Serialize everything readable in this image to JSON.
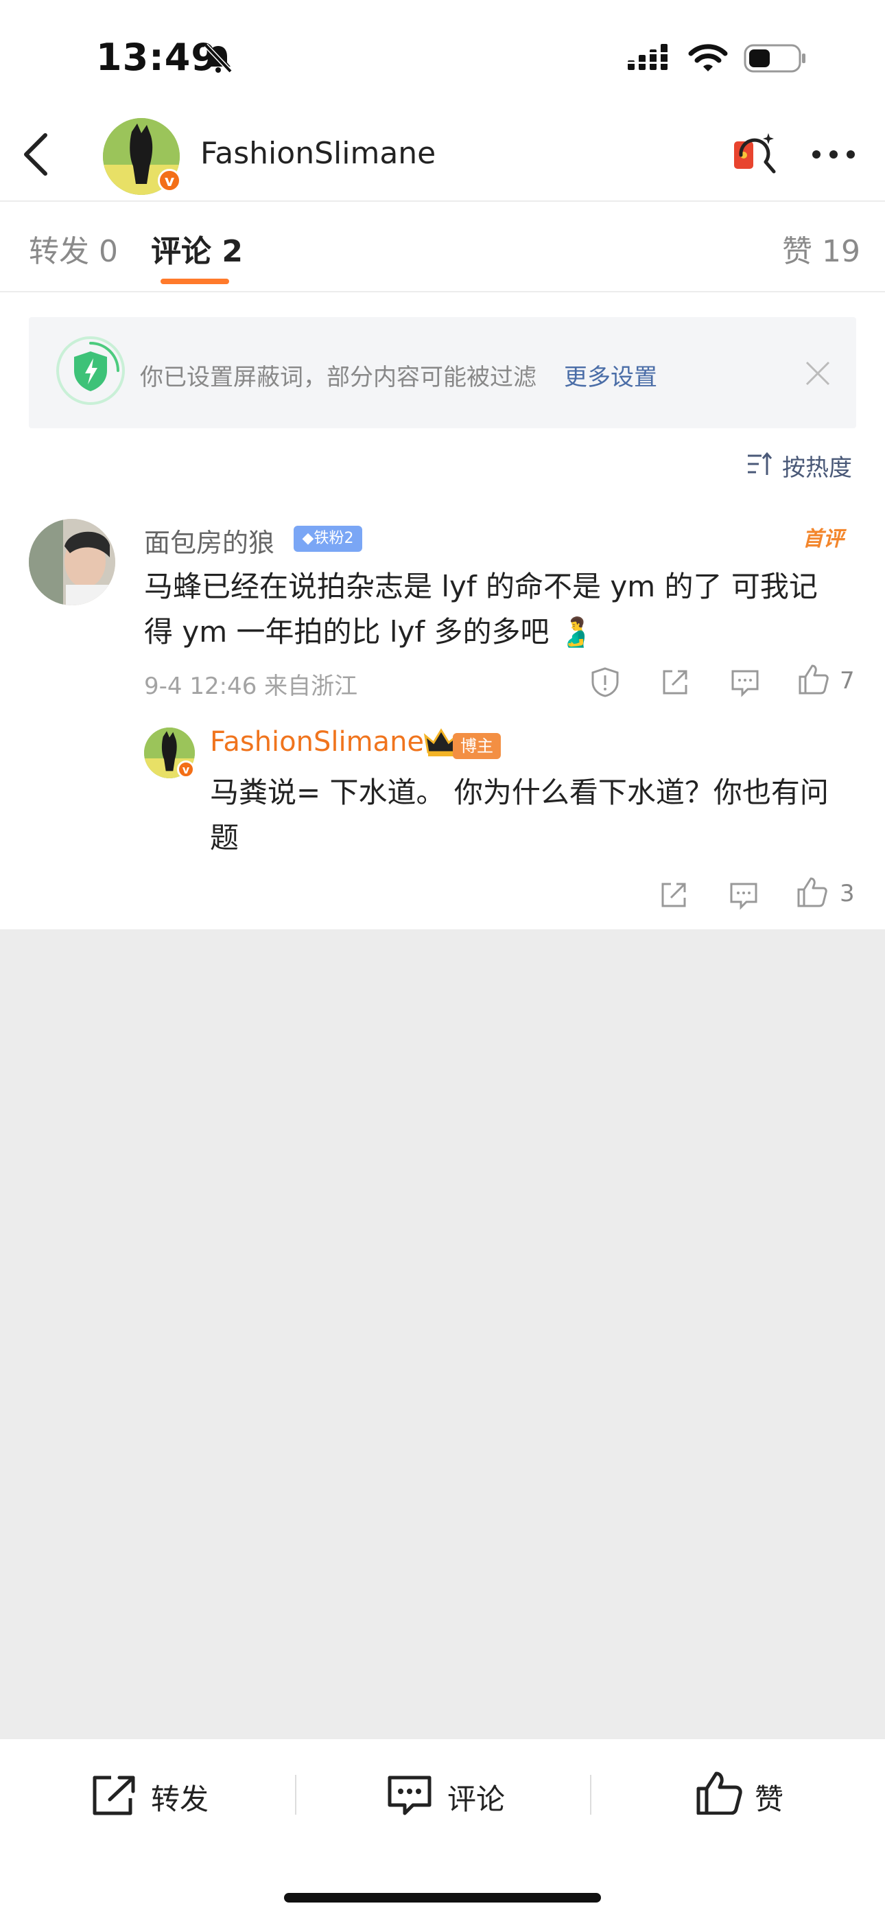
{
  "status_bar": {
    "time": "13:49"
  },
  "header": {
    "username": "FashionSlimane"
  },
  "tabs": [
    {
      "label": "转发",
      "count": "0"
    },
    {
      "label": "评论",
      "count": "2"
    },
    {
      "label": "赞",
      "count": "19"
    }
  ],
  "filter_banner": {
    "text": "你已设置屏蔽词，部分内容可能被过滤",
    "link": "更多设置"
  },
  "sort": {
    "label": "按热度"
  },
  "comment": {
    "username": "面包房的狼",
    "fan_badge": "铁粉2",
    "first_badge": "首评",
    "text": "马蜂已经在说拍杂志是 lyf 的命不是 ym 的了 可我记得 ym 一年拍的比 lyf 多的多吧 🫃",
    "time": "9-4 12:46",
    "location": "来自浙江",
    "likes": "7"
  },
  "reply": {
    "username": "FashionSlimane",
    "badge": "博主",
    "text": "马粪说= 下水道。  你为什么看下水道？你也有问题",
    "likes": "3"
  },
  "bottom_bar": {
    "repost": "转发",
    "comment": "评论",
    "like": "赞"
  },
  "colors": {
    "accent": "#ff7a2b",
    "link": "#4a6da7",
    "name_orange": "#f0741d",
    "background": "#ececec"
  }
}
